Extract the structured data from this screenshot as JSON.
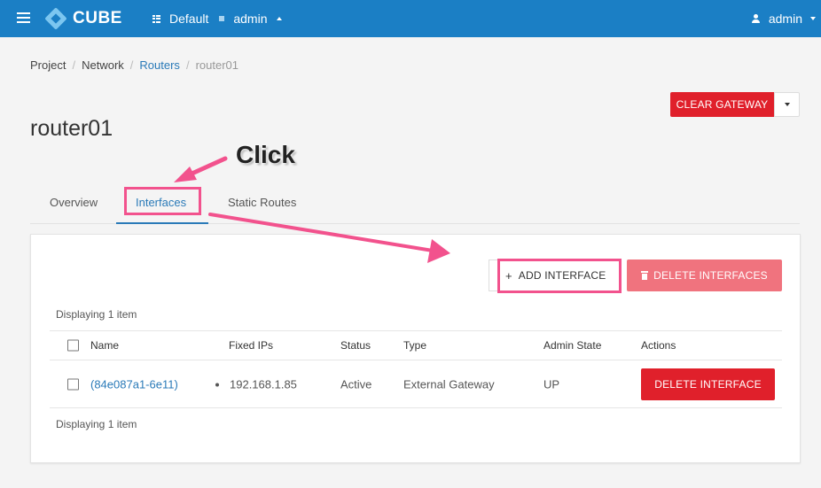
{
  "brand": {
    "name": "CUBE"
  },
  "topnav": {
    "domain": "Default",
    "project": "admin",
    "user": "admin"
  },
  "breadcrumb": {
    "items": [
      "Project",
      "Network",
      "Routers",
      "router01"
    ]
  },
  "actions": {
    "clear_gateway": "CLEAR GATEWAY"
  },
  "page": {
    "title": "router01"
  },
  "annotation": {
    "click": "Click"
  },
  "tabs": [
    "Overview",
    "Interfaces",
    "Static Routes"
  ],
  "table_actions": {
    "add_interface": "ADD INTERFACE",
    "delete_interfaces": "DELETE INTERFACES"
  },
  "table": {
    "displaying_top": "Displaying 1 item",
    "displaying_bottom": "Displaying 1 item",
    "columns": [
      "Name",
      "Fixed IPs",
      "Status",
      "Type",
      "Admin State",
      "Actions"
    ],
    "rows": [
      {
        "name": "(84e087a1-6e11)",
        "fixed_ip": "192.168.1.85",
        "status": "Active",
        "type": "External Gateway",
        "admin_state": "UP",
        "action": "DELETE INTERFACE"
      }
    ]
  },
  "colors": {
    "nav": "#1b7fc5",
    "danger": "#e0202b",
    "danger_light": "#f0737e",
    "highlight": "#f2528d",
    "link": "#2a7ab8"
  }
}
